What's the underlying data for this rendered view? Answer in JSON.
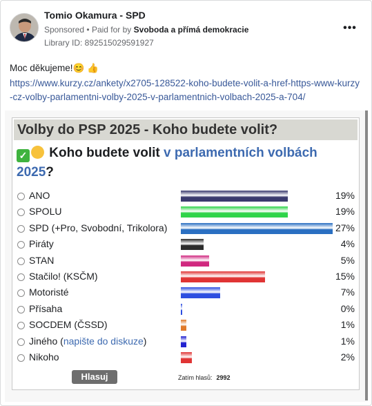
{
  "post": {
    "page_name": "Tomio Okamura - SPD",
    "sponsored": "Sponsored",
    "paid_for_prefix": "Paid for by",
    "payer": "Svoboda a přímá demokracie",
    "library_id": "Library ID: 892515029591927",
    "more_icon": "more-icon",
    "message": "Moc děkujeme!😊 👍",
    "link": "https://www.kurzy.cz/ankety/x2705-128522-koho-budete-volit-a-href-https-www-kurzy-cz-volby-parlamentni-volby-2025-v-parlamentnich-volbach-2025-a-704/"
  },
  "poll": {
    "header": "Volby do PSP 2025 - Koho budete volit?",
    "question_part1": "Koho budete volit ",
    "question_part2": "v parlamentních volbách",
    "question_part3": "2025",
    "question_end": "?",
    "options": [
      {
        "label": "ANO",
        "pct": "19%",
        "value": 19,
        "color": "#3a3a6e"
      },
      {
        "label": "SPOLU",
        "pct": "19%",
        "value": 19,
        "color": "#2fd44a"
      },
      {
        "label": "SPD (+Pro, Svobodní, Trikolora)",
        "pct": "27%",
        "value": 27,
        "color": "#2a6fc2"
      },
      {
        "label": "Piráty",
        "pct": "4%",
        "value": 4,
        "color": "#2b2b2b"
      },
      {
        "label": "STAN",
        "pct": "5%",
        "value": 5,
        "color": "#d0287f"
      },
      {
        "label": "Stačilo! (KSČM)",
        "pct": "15%",
        "value": 15,
        "color": "#e03434"
      },
      {
        "label": "Motoristé",
        "pct": "7%",
        "value": 7,
        "color": "#2d4ee0"
      },
      {
        "label": "Přísaha",
        "pct": "0%",
        "value": 0.2,
        "color": "#2d4ee0"
      },
      {
        "label": "SOCDEM (ČSSD)",
        "pct": "1%",
        "value": 1,
        "color": "#e07a2a"
      },
      {
        "label": "Jiného (",
        "label_link": "napište do diskuze",
        "label_end": ")",
        "pct": "1%",
        "value": 1,
        "color": "#2222d0"
      },
      {
        "label": "Nikoho",
        "pct": "2%",
        "value": 2,
        "color": "#e03434"
      }
    ],
    "vote_button": "Hlasuj",
    "total_label": "Zatím hlasů:",
    "total_value": "2992"
  }
}
